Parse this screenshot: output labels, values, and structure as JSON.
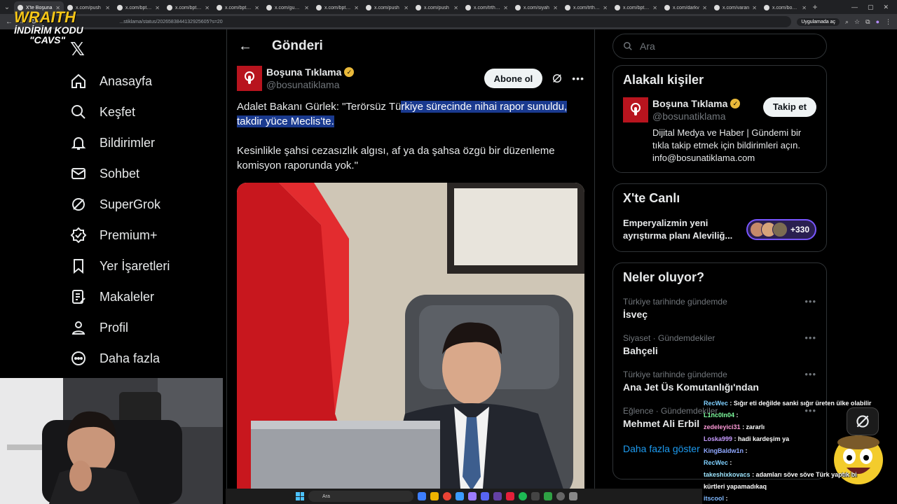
{
  "browser": {
    "tabs": [
      {
        "label": "X'te Boşuna",
        "active": true
      },
      {
        "label": "x.com/push"
      },
      {
        "label": "x.com/bpthal"
      },
      {
        "label": "x.com/bpthal"
      },
      {
        "label": "x.com/bpthal"
      },
      {
        "label": "x.com/gunde"
      },
      {
        "label": "x.com/bpthal"
      },
      {
        "label": "x.com/push"
      },
      {
        "label": "x.com/push"
      },
      {
        "label": "x.com/trthab"
      },
      {
        "label": "x.com/siyah"
      },
      {
        "label": "x.com/trthab"
      },
      {
        "label": "x.com/bpthal"
      },
      {
        "label": "x.com/darkv"
      },
      {
        "label": "x.com/varan"
      },
      {
        "label": "x.com/bosun"
      }
    ],
    "url": "...stiklama/status/2026583844132925605?s=20",
    "app_pill": "Uygulamada aç"
  },
  "overlay": {
    "brand": "WRAITH",
    "promo_line1": "İNDİRİM KODU",
    "promo_code": "\"CAVS\""
  },
  "nav": {
    "items": [
      {
        "label": "Anasayfa",
        "icon": "home-icon"
      },
      {
        "label": "Keşfet",
        "icon": "search-icon"
      },
      {
        "label": "Bildirimler",
        "icon": "bell-icon"
      },
      {
        "label": "Sohbet",
        "icon": "mail-icon"
      },
      {
        "label": "SuperGrok",
        "icon": "grok-icon"
      },
      {
        "label": "Premium+",
        "icon": "premium-icon"
      },
      {
        "label": "Yer İşaretleri",
        "icon": "bookmark-icon"
      },
      {
        "label": "Makaleler",
        "icon": "articles-icon"
      },
      {
        "label": "Profil",
        "icon": "profile-icon"
      },
      {
        "label": "Daha fazla",
        "icon": "more-circle-icon"
      }
    ]
  },
  "main": {
    "title": "Gönderi",
    "post": {
      "author": "Boşuna Tıklama",
      "handle": "@bosunatiklama",
      "subscribe_label": "Abone ol",
      "text_plain": "Adalet Bakanı Gürlek: \"Terörsüz Tü",
      "text_selected_1": "rkiye sürecinde nihai rapor sunuldu,",
      "text_selected_2": "takdir yüce Meclis'te.",
      "text_p2": "Kesinlikle şahsi cezasızlık algısı, af ya da şahsa özgü bir düzenleme komisyon raporunda yok.\""
    }
  },
  "right": {
    "search_placeholder": "Ara",
    "related": {
      "title": "Alakalı kişiler",
      "name": "Boşuna Tıklama",
      "handle": "@bosunatiklama",
      "follow_label": "Takip et",
      "bio": "Dijital Medya ve Haber | Gündemi bir tıkla takip etmek için bildirimleri açın. info@bosunatiklama.com"
    },
    "live": {
      "title": "X'te Canlı",
      "text": "Emperyalizmin yeni ayrıştırma planı Aleviliğ...",
      "count": "+330"
    },
    "trends": {
      "title": "Neler oluyor?",
      "items": [
        {
          "meta": "Türkiye tarihinde gündemde",
          "name": "İsveç"
        },
        {
          "meta": "Siyaset · Gündemdekiler",
          "name": "Bahçeli"
        },
        {
          "meta": "Türkiye tarihinde gündemde",
          "name": "Ana Jet Üs Komutanlığı'ndan"
        },
        {
          "meta": "Eğlence · Gündemdekiler",
          "name": "Mehmet Ali Erbil"
        }
      ],
      "show_more": "Daha fazla göster"
    }
  },
  "chat": [
    {
      "user": "RecWec",
      "color": "#7fd0ff",
      "msg": ": Sığır eti değilde sanki sığır üreten ülke olabilir"
    },
    {
      "user": "L1nc0ln04",
      "color": "#7fffa0",
      "msg": ":"
    },
    {
      "user": "zedeleyici31",
      "color": "#ff9ad8",
      "msg": ": zararlı"
    },
    {
      "user": "Loska999",
      "color": "#c79bff",
      "msg": ": hadi kardeşim ya"
    },
    {
      "user": "KingBaldw1n",
      "color": "#8fa8ff",
      "msg": ":"
    },
    {
      "user": "RecWec",
      "color": "#7fd0ff",
      "msg": ":"
    },
    {
      "user": "takeshixkovacs",
      "color": "#9ee6ff",
      "msg": ": adamları söve söve Türk yaptık bi"
    },
    {
      "user": "",
      "color": "#ffffff",
      "msg": "kürtleri yapamadıkaq"
    },
    {
      "user": "itscool",
      "color": "#7fb8ff",
      "msg": ":"
    }
  ],
  "taskbar": {
    "search": "Ara"
  }
}
